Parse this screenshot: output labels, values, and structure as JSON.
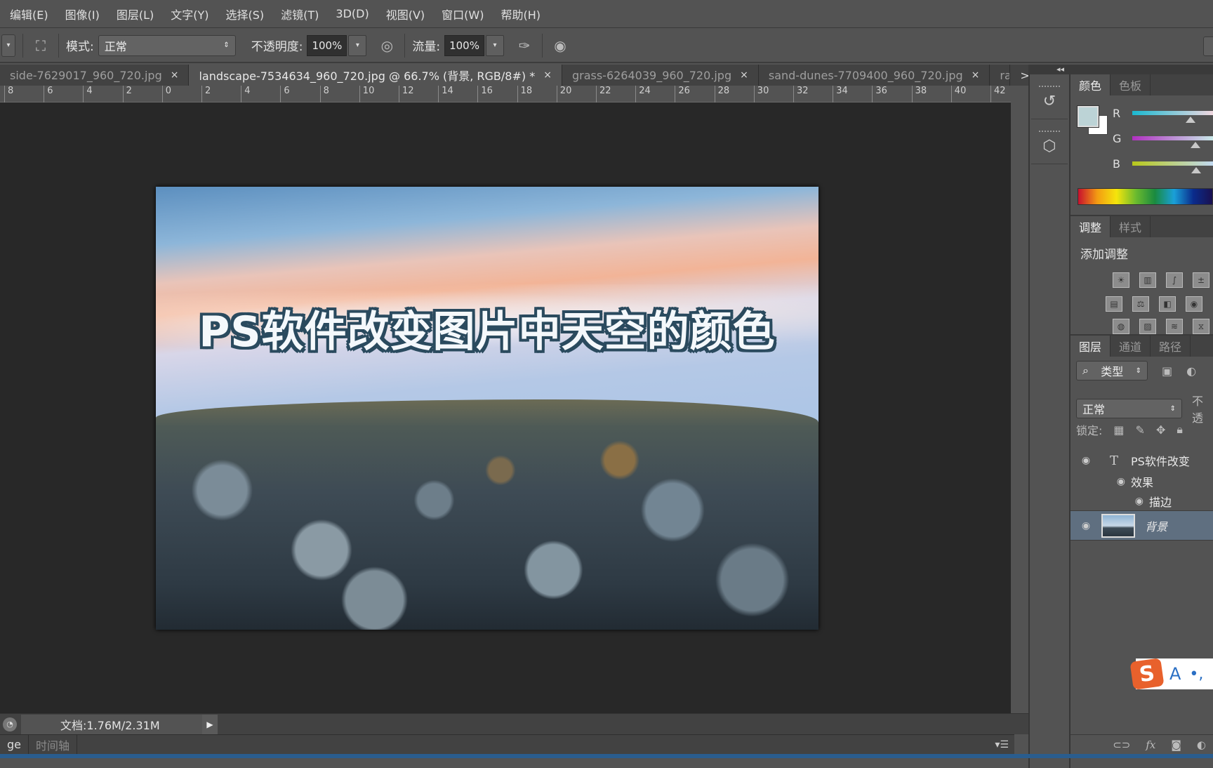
{
  "menu": [
    "编辑(E)",
    "图像(I)",
    "图层(L)",
    "文字(Y)",
    "选择(S)",
    "滤镜(T)",
    "3D(D)",
    "视图(V)",
    "窗口(W)",
    "帮助(H)"
  ],
  "options": {
    "mode_label": "模式:",
    "mode_value": "正常",
    "opacity_label": "不透明度:",
    "opacity_value": "100%",
    "flow_label": "流量:",
    "flow_value": "100%"
  },
  "doc_tabs": [
    {
      "label": "side-7629017_960_720.jpg",
      "active": false
    },
    {
      "label": "landscape-7534634_960_720.jpg @ 66.7% (背景, RGB/8#) *",
      "active": true
    },
    {
      "label": "grass-6264039_960_720.jpg",
      "active": false
    },
    {
      "label": "sand-dunes-7709400_960_720.jpg",
      "active": false
    },
    {
      "label": "rat",
      "active": false
    }
  ],
  "tabs_overflow": ">>",
  "ruler_ticks": [
    "8",
    "6",
    "4",
    "2",
    "0",
    "2",
    "4",
    "6",
    "8",
    "10",
    "12",
    "14",
    "16",
    "18",
    "20",
    "22",
    "24",
    "26",
    "28",
    "30",
    "32",
    "34",
    "36",
    "38",
    "40",
    "42"
  ],
  "canvas": {
    "overlay_text": "PS软件改变图片中天空的颜色"
  },
  "status": {
    "doc_info": "文档:1.76M/2.31M"
  },
  "bottom_tabs": [
    "ge",
    "时间轴"
  ],
  "color_panel": {
    "tabs": [
      "颜色",
      "色板"
    ],
    "channels": [
      {
        "label": "R",
        "value_fraction": 0.72,
        "gradient": [
          "#1ab8d0",
          "#f0d8e0"
        ]
      },
      {
        "label": "G",
        "value_fraction": 0.78,
        "gradient": [
          "#b030c0",
          "#c8e8e8"
        ]
      },
      {
        "label": "B",
        "value_fraction": 0.79,
        "gradient": [
          "#b8c81a",
          "#c0d8f0"
        ]
      }
    ],
    "foreground_color": "#bcd3d6",
    "background_color": "#ffffff"
  },
  "adjust_panel": {
    "tabs": [
      "调整",
      "样式"
    ],
    "title": "添加调整",
    "row1": [
      "brightness-contrast",
      "levels",
      "curves",
      "exposure"
    ],
    "row2": [
      "hue-saturation",
      "color-balance",
      "black-white",
      "photo-filter"
    ],
    "row3": [
      "invert",
      "posterize",
      "threshold",
      "gradient-map"
    ]
  },
  "layers_panel": {
    "tabs": [
      "图层",
      "通道",
      "路径"
    ],
    "filter_label": "类型",
    "blend_mode": "正常",
    "opacity_label": "不透",
    "lock_label": "锁定:",
    "layers": [
      {
        "name": "PS软件改变",
        "type": "text",
        "visible": true
      },
      {
        "name": "效果",
        "type": "effects",
        "visible": true
      },
      {
        "name": "描边",
        "type": "effect",
        "visible": true
      },
      {
        "name": "背景",
        "type": "image",
        "visible": true,
        "selected": true
      }
    ]
  },
  "ime": {
    "logo": "S",
    "mode": "A",
    "punct": "•,"
  }
}
